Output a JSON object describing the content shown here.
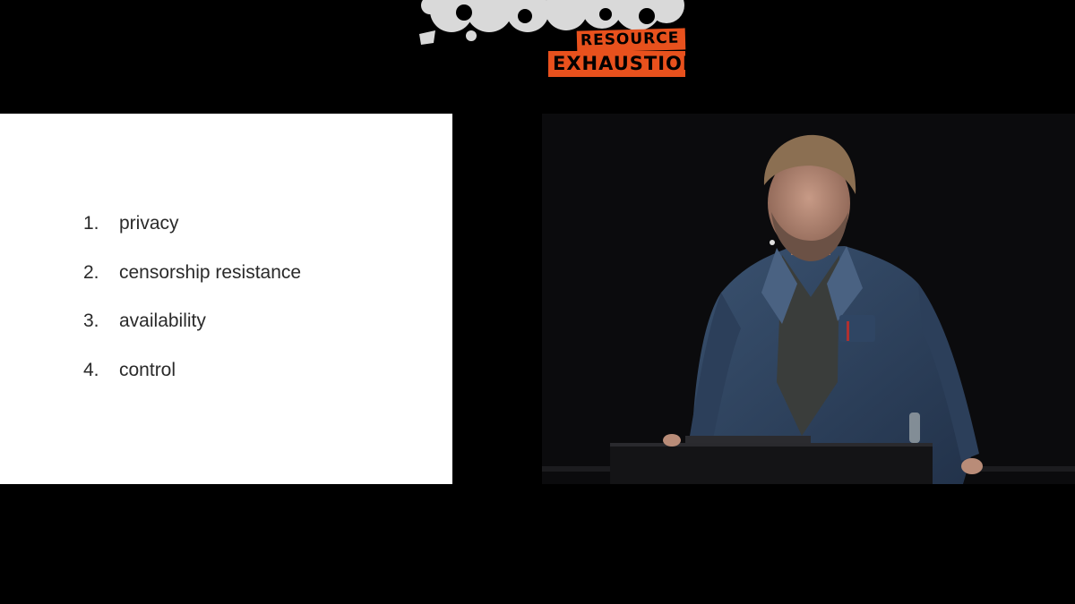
{
  "logo": {
    "line1": "RESOURCE",
    "line2": "EXHAUSTION",
    "accent_color": "#e8511d",
    "blob_color": "#d9d9d9"
  },
  "slide": {
    "items": [
      {
        "num": "1.",
        "text": "privacy"
      },
      {
        "num": "2.",
        "text": "censorship resistance"
      },
      {
        "num": "3.",
        "text": "availability"
      },
      {
        "num": "4.",
        "text": "control"
      }
    ]
  },
  "video": {
    "icon": "speaker-at-podium-photo"
  }
}
